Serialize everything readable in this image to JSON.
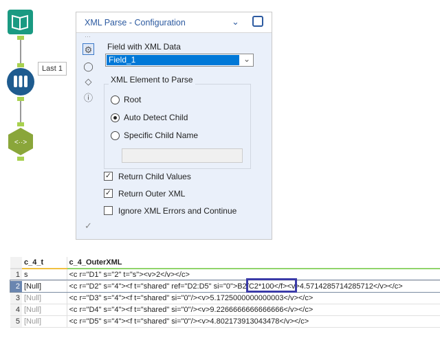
{
  "workflow": {
    "browse_label": "Last 1"
  },
  "panel": {
    "title": "XML Parse - Configuration",
    "field_label": "Field with XML Data",
    "field_value": "Field_1",
    "group_label": "XML Element to Parse",
    "radios": [
      {
        "label": "Root",
        "selected": false
      },
      {
        "label": "Auto Detect Child",
        "selected": true
      },
      {
        "label": "Specific Child Name",
        "selected": false
      }
    ],
    "child_name_value": "",
    "checkboxes": [
      {
        "label": "Return Child Values",
        "checked": true
      },
      {
        "label": "Return Outer XML",
        "checked": true
      },
      {
        "label": "Ignore XML Errors and Continue",
        "checked": false
      }
    ]
  },
  "table": {
    "columns": [
      "c_4_t",
      "c_4_OuterXML"
    ],
    "rows": [
      {
        "n": "1",
        "t": "s",
        "xml": "<c r=\"D1\" s=\"2\" t=\"s\"><v>2</v></c>"
      },
      {
        "n": "2",
        "t": "[Null]",
        "xml": "<c r=\"D2\" s=\"4\"><f t=\"shared\" ref=\"D2:D5\" si=\"0\">B2/C2*100</f><v>4.5714285714285712</v></c>"
      },
      {
        "n": "3",
        "t": "[Null]",
        "xml": "<c r=\"D3\" s=\"4\"><f t=\"shared\" si=\"0\"/><v>5.1725000000000003</v></c>"
      },
      {
        "n": "4",
        "t": "[Null]",
        "xml": "<c r=\"D4\" s=\"4\"><f t=\"shared\" si=\"0\"/><v>9.2266666666666666</v></c>"
      },
      {
        "n": "5",
        "t": "[Null]",
        "xml": "<c r=\"D5\" s=\"4\"><f t=\"shared\" si=\"0\"/><v>4.802173913043478</v></c>"
      }
    ]
  },
  "colors": {
    "accent": "#0078d7",
    "highlight_box": "#3a3aa8",
    "input_tool": "#1a9a82",
    "browse_tool": "#1e5b8f",
    "xml_tool": "#8aa63a"
  }
}
